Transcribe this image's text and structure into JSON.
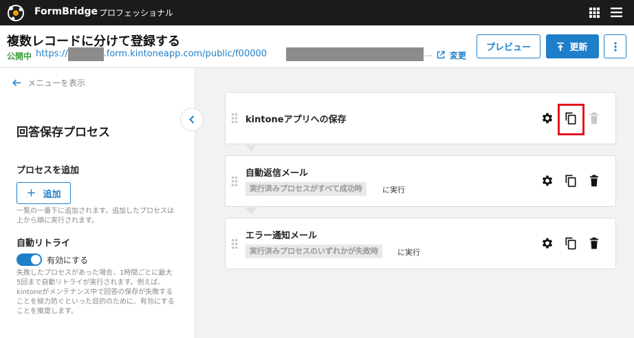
{
  "topbar": {
    "brand": "FormBridge",
    "plan": "プロフェッショナル",
    "icons": [
      "formbridge-logo-icon",
      "app-grid-icon",
      "hamburger-menu-icon"
    ]
  },
  "header": {
    "title": "複数レコードに分けて登録する",
    "status": "公開中",
    "url_prefix": "https://",
    "url_mid": ".form.kintoneapp.com/public/f00000",
    "url_ellipsis": "…",
    "change_label": "変更",
    "preview_label": "プレビュー",
    "update_label": "更新"
  },
  "left": {
    "back_label": "メニューを表示",
    "section_title": "回答保存プロセス",
    "add_heading": "プロセスを追加",
    "add_button": "追加",
    "add_help": "一覧の一番下に追加されます。追加したプロセスは上から順に実行されます。",
    "retry_heading": "自動リトライ",
    "retry_toggle_label": "有効にする",
    "retry_enabled": true,
    "retry_help": "失敗したプロセスがあった場合、1時間ごとに最大5回まで自動リトライが実行されます。例えば、kintoneがメンテナンス中で回答の保存が失敗することを極力防ぐといった目的のために、有効にすることを推奨します。"
  },
  "processes": [
    {
      "title": "kintoneアプリへの保存",
      "condition": "",
      "suffix": "",
      "delete_enabled": false
    },
    {
      "title": "自動返信メール",
      "condition": "実行済みプロセスがすべて成功時",
      "suffix": "に実行",
      "delete_enabled": true
    },
    {
      "title": "エラー通知メール",
      "condition": "実行済みプロセスのいずれかが失敗時",
      "suffix": "に実行",
      "delete_enabled": true
    }
  ],
  "colors": {
    "accent": "#1e7fc9",
    "published": "#3a9c3a",
    "highlight": "#e2141f",
    "topbar": "#1b1b1b"
  }
}
